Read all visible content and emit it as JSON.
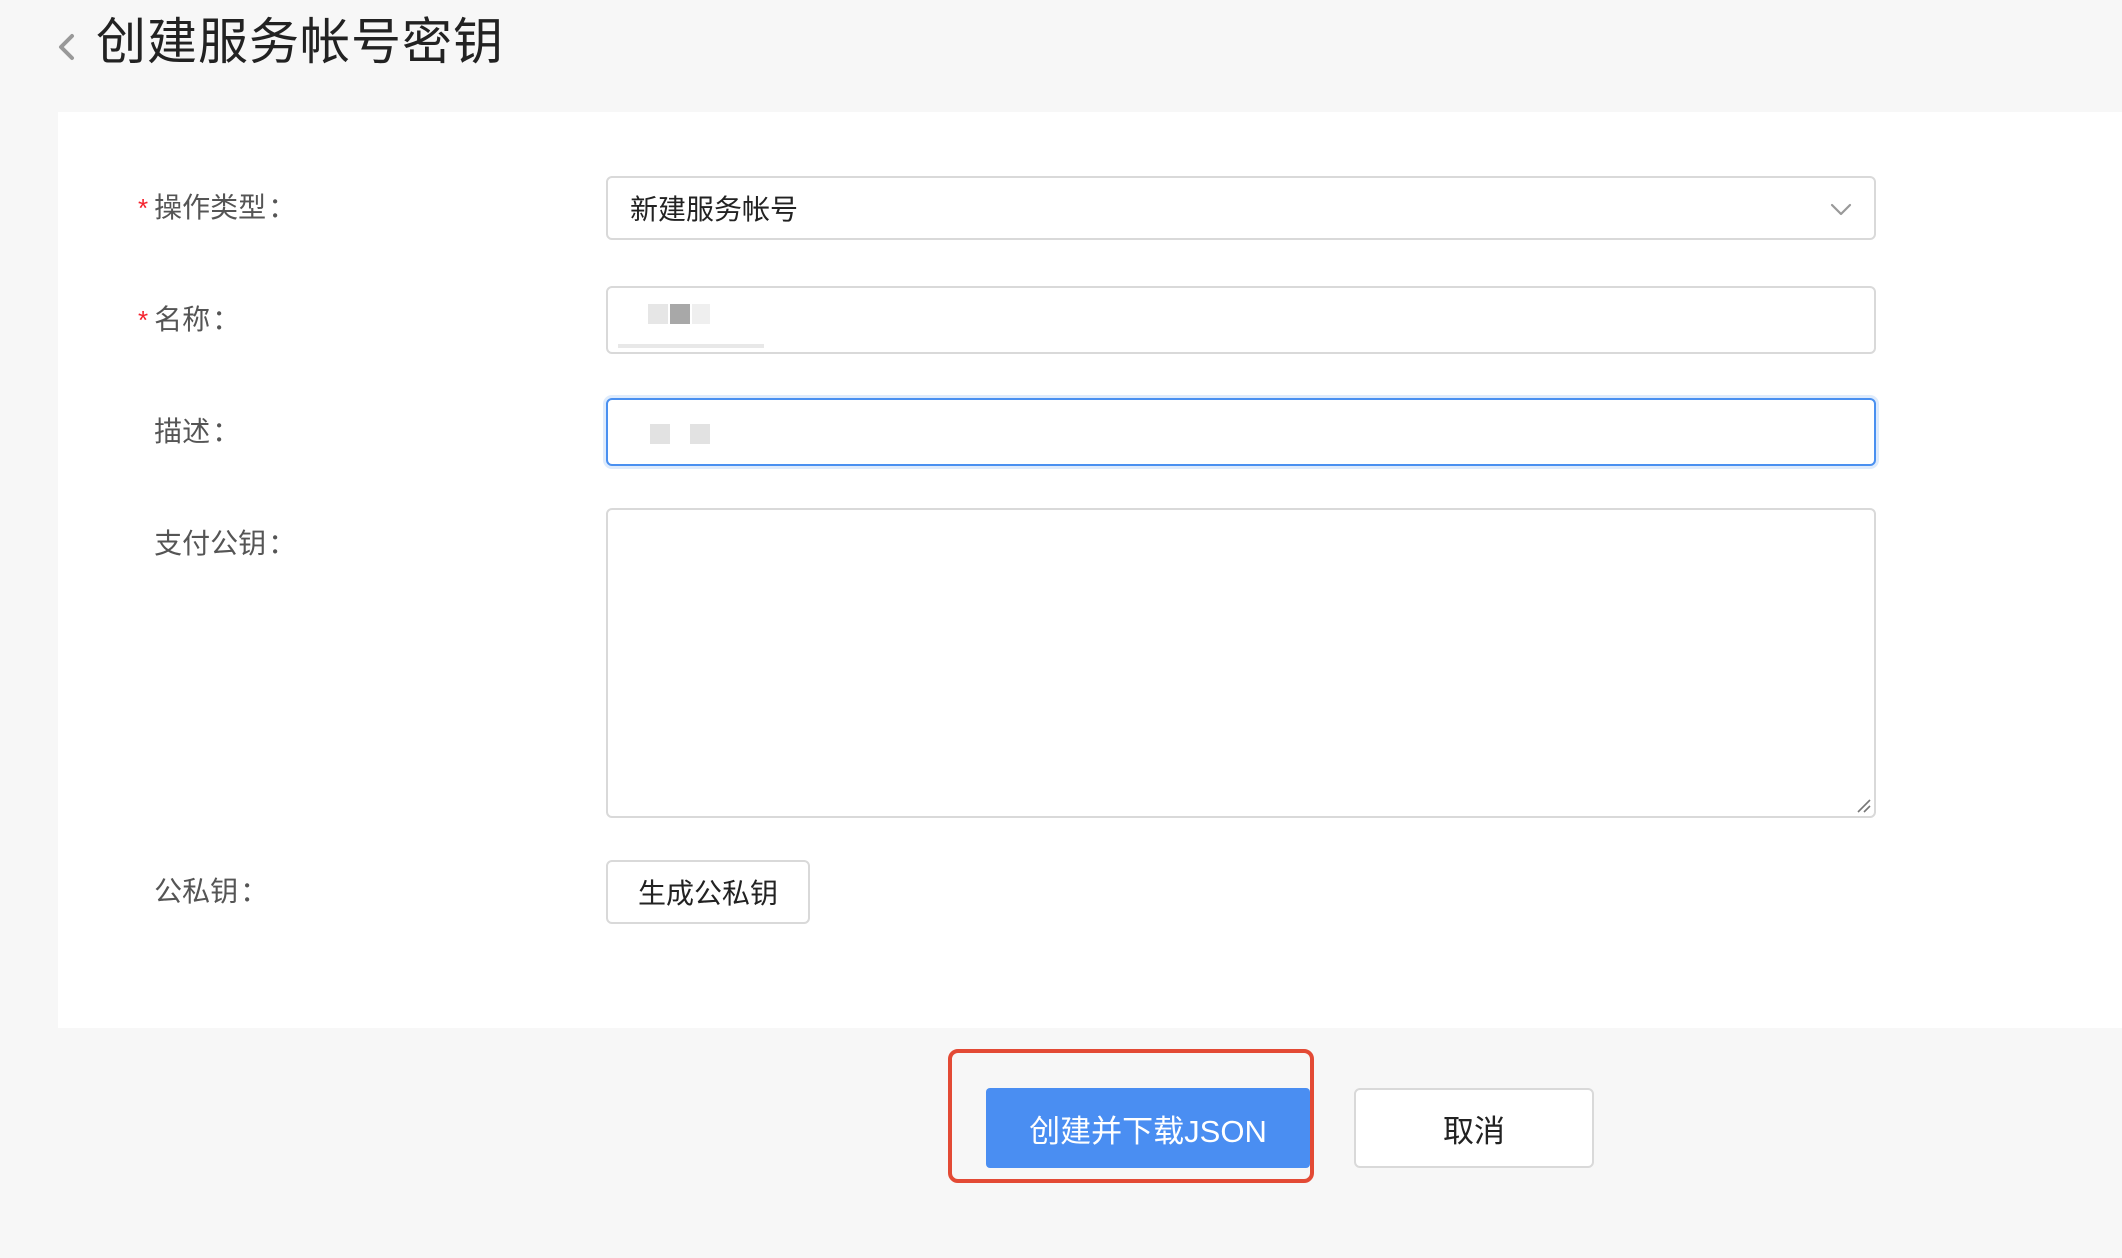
{
  "header": {
    "title": "创建服务帐号密钥"
  },
  "form": {
    "colon": "：",
    "operation_type": {
      "label": "操作类型",
      "value": "新建服务帐号"
    },
    "name": {
      "label": "名称"
    },
    "description": {
      "label": "描述"
    },
    "payment_public_key": {
      "label": "支付公钥",
      "value": ""
    },
    "key_pair": {
      "label": "公私钥",
      "button_label": "生成公私钥"
    }
  },
  "footer": {
    "create_download_label": "创建并下载JSON",
    "cancel_label": "取消"
  },
  "colors": {
    "primary": "#4a8ef2",
    "required": "#f5222d",
    "highlight": "#e34a35",
    "focus": "#4a90f0"
  },
  "icons": {
    "back": "chevron-left-icon",
    "dropdown": "chevron-down-icon",
    "resize": "resize-grip-icon"
  }
}
